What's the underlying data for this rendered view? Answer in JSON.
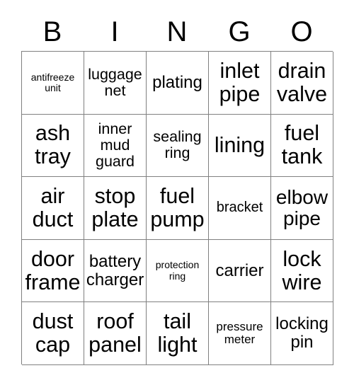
{
  "card": {
    "title": "BINGO",
    "header_letters": [
      "B",
      "I",
      "N",
      "G",
      "O"
    ],
    "grid_size": "5x5",
    "colors": {
      "background": "#ffffff",
      "text": "#000000",
      "border": "#808080"
    },
    "rows": [
      [
        {
          "label": "antifreeze\nunit",
          "size": "fs-xs"
        },
        {
          "label": "luggage\nnet",
          "size": "fs-mdl"
        },
        {
          "label": "plating",
          "size": "fs-lg"
        },
        {
          "label": "inlet\npipe",
          "size": "fs-xxl"
        },
        {
          "label": "drain\nvalve",
          "size": "fs-xxl"
        }
      ],
      [
        {
          "label": "ash\ntray",
          "size": "fs-xxl"
        },
        {
          "label": "inner\nmud\nguard",
          "size": "fs-mdl"
        },
        {
          "label": "sealing\nring",
          "size": "fs-mdl"
        },
        {
          "label": "lining",
          "size": "fs-xxl"
        },
        {
          "label": "fuel\ntank",
          "size": "fs-xxl"
        }
      ],
      [
        {
          "label": "air\nduct",
          "size": "fs-xxl"
        },
        {
          "label": "stop\nplate",
          "size": "fs-xxl"
        },
        {
          "label": "fuel\npump",
          "size": "fs-xxl"
        },
        {
          "label": "bracket",
          "size": "fs-md"
        },
        {
          "label": "elbow\npipe",
          "size": "fs-xl"
        }
      ],
      [
        {
          "label": "door\nframe",
          "size": "fs-xxl"
        },
        {
          "label": "battery\ncharger",
          "size": "fs-lg"
        },
        {
          "label": "protection\nring",
          "size": "fs-xs"
        },
        {
          "label": "carrier",
          "size": "fs-lg"
        },
        {
          "label": "lock\nwire",
          "size": "fs-xxl"
        }
      ],
      [
        {
          "label": "dust\ncap",
          "size": "fs-xxl"
        },
        {
          "label": "roof\npanel",
          "size": "fs-xxl"
        },
        {
          "label": "tail\nlight",
          "size": "fs-xxl"
        },
        {
          "label": "pressure\nmeter",
          "size": "fs-sm"
        },
        {
          "label": "locking\npin",
          "size": "fs-lg"
        }
      ]
    ]
  }
}
